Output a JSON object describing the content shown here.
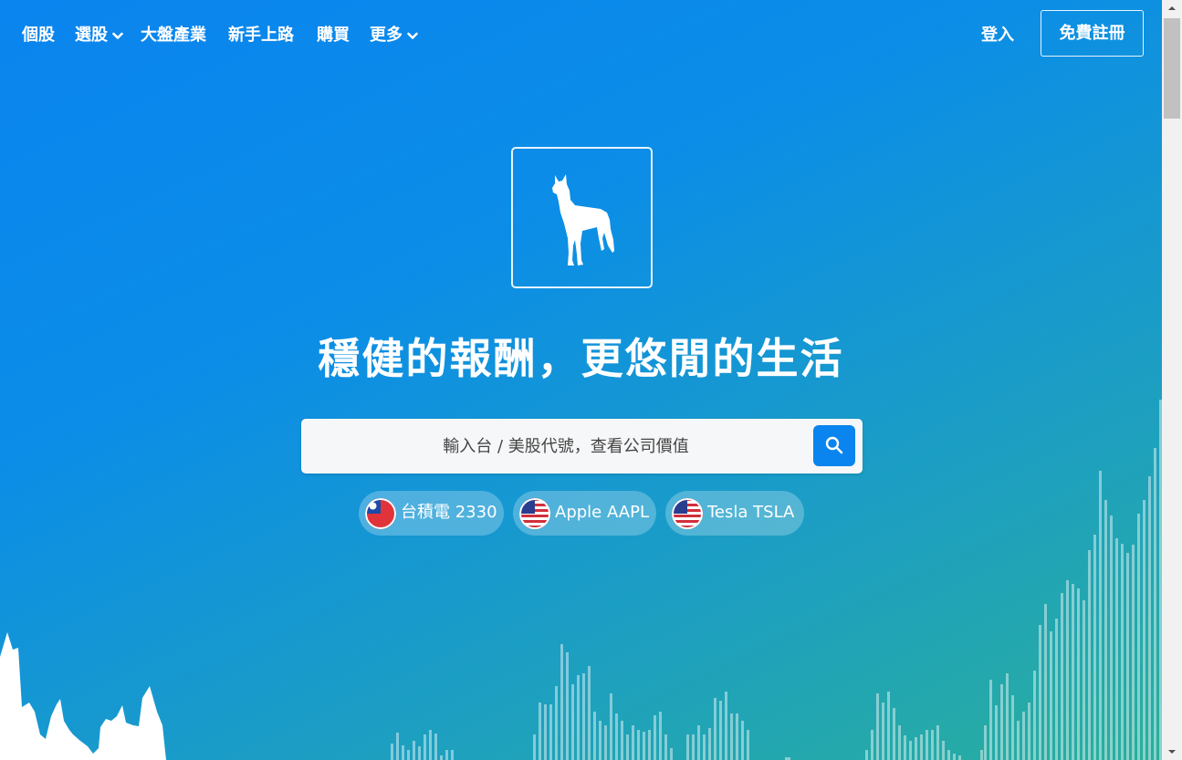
{
  "nav": {
    "items": [
      {
        "label": "個股",
        "has_dropdown": false
      },
      {
        "label": "選股",
        "has_dropdown": true
      },
      {
        "label": "大盤產業",
        "has_dropdown": false
      },
      {
        "label": "新手上路",
        "has_dropdown": false
      },
      {
        "label": "購買",
        "has_dropdown": false
      },
      {
        "label": "更多",
        "has_dropdown": true
      }
    ],
    "login_label": "登入",
    "signup_label": "免費註冊"
  },
  "logo": {
    "icon": "dog-silhouette-icon"
  },
  "hero": {
    "headline": "穩健的報酬，更悠閒的生活"
  },
  "search": {
    "placeholder": "輸入台 / 美股代號，查看公司價值",
    "value": "",
    "button_icon": "search-icon"
  },
  "quick_picks": [
    {
      "label": "台積電 2330",
      "flag": "taiwan-flag-icon"
    },
    {
      "label": "Apple AAPL",
      "flag": "us-flag-icon"
    },
    {
      "label": "Tesla TSLA",
      "flag": "us-flag-icon"
    }
  ],
  "colors": {
    "accent": "#0a84ee",
    "gradient_start": "#0a84ee",
    "gradient_end": "#2aaf9c"
  }
}
